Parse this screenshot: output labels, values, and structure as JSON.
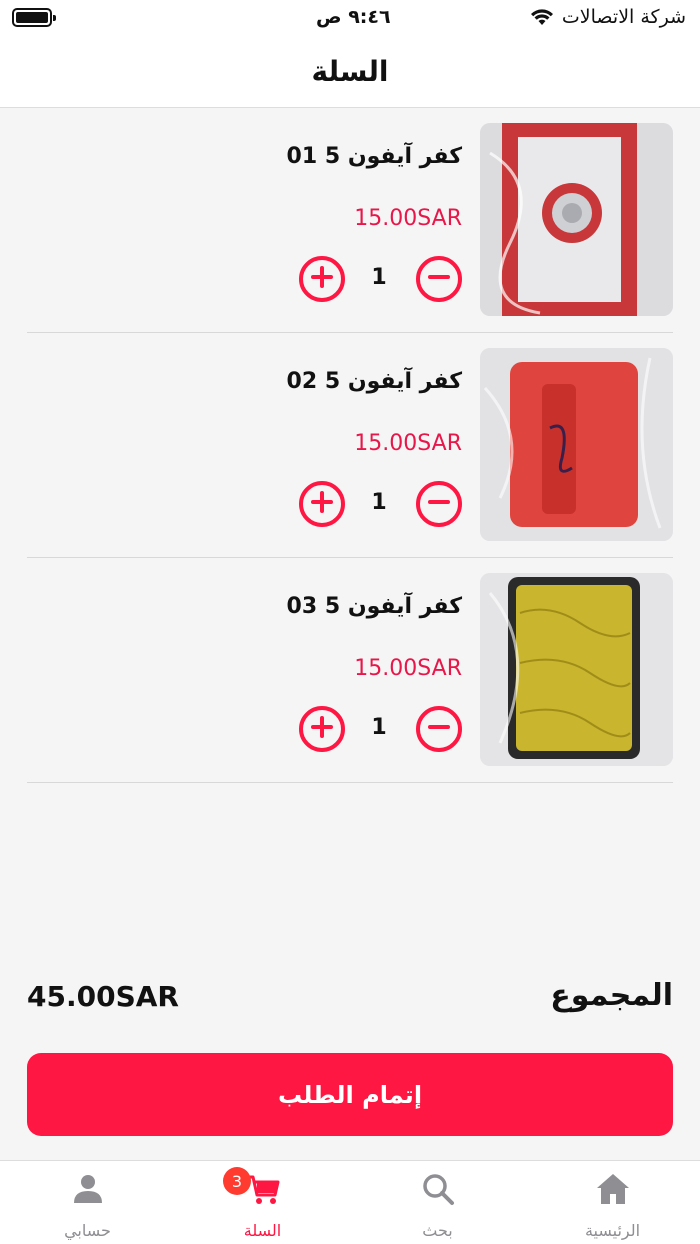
{
  "status_bar": {
    "carrier": "شركة الاتصالات",
    "time": "٩:٤٦ ص"
  },
  "header": {
    "title": "السلة"
  },
  "cart": {
    "items": [
      {
        "name": "كفر آيفون 5 01",
        "price": "15.00SAR",
        "quantity": "1"
      },
      {
        "name": "كفر آيفون 5 02",
        "price": "15.00SAR",
        "quantity": "1"
      },
      {
        "name": "كفر آيفون 5 03",
        "price": "15.00SAR",
        "quantity": "1"
      }
    ]
  },
  "summary": {
    "total_label": "المجموع",
    "total_value": "45.00SAR",
    "checkout_label": "إتمام الطلب"
  },
  "tabs": [
    {
      "label": "حسابي",
      "icon": "user-icon"
    },
    {
      "label": "السلة",
      "icon": "cart-icon",
      "badge": "3"
    },
    {
      "label": "بحث",
      "icon": "search-icon"
    },
    {
      "label": "الرئيسية",
      "icon": "home-icon"
    }
  ],
  "colors": {
    "accent": "#ff1744",
    "price": "#e8174a",
    "badge": "#ff3b30",
    "tab_inactive": "#8e8e93"
  }
}
